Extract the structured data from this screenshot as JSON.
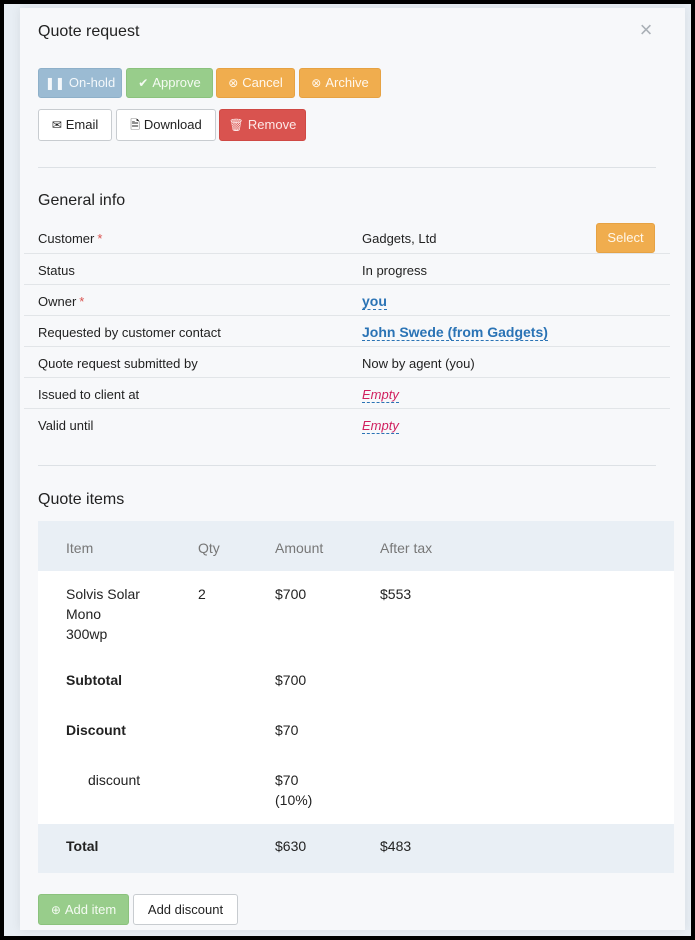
{
  "dialog": {
    "title": "Quote request",
    "close_icon": "×"
  },
  "actions": {
    "on_hold": "On-hold",
    "approve": "Approve",
    "cancel": "Cancel",
    "archive": "Archive",
    "email": "Email",
    "download": "Download",
    "remove": "Remove"
  },
  "general": {
    "heading": "General info",
    "select_label": "Select",
    "rows": [
      {
        "label": "Customer",
        "value": "Gadgets, Ltd",
        "required": "*"
      },
      {
        "label": "Status",
        "value": "In progress"
      },
      {
        "label": "Owner",
        "value": "you",
        "required": "*"
      },
      {
        "label": "Requested by customer contact",
        "value": "John Swede (from Gadgets)"
      },
      {
        "label": "Quote request submitted by",
        "value": "Now by agent (you)"
      },
      {
        "label": "Issued to client at",
        "value": "Empty"
      },
      {
        "label": "Valid until",
        "value": "Empty"
      }
    ]
  },
  "items": {
    "heading": "Quote items",
    "columns": [
      "Item",
      "Qty",
      "Amount",
      "After tax"
    ],
    "row": {
      "item_line1": "Solvis Solar",
      "item_line2": "Mono",
      "item_line3": "300wp",
      "qty": "2",
      "amount": "$700",
      "after_tax": "$553"
    },
    "subtotal": {
      "label": "Subtotal",
      "amount": "$700"
    },
    "discount": {
      "label": "Discount",
      "amount": "$70"
    },
    "discount_line": {
      "label": "discount",
      "amount": "$70",
      "percent": "(10%)"
    },
    "total": {
      "label": "Total",
      "amount": "$630",
      "after_tax": "$483"
    },
    "add_item": "Add item",
    "add_discount": "Add discount"
  },
  "colors": {
    "accent_link": "#2a73b5",
    "empty": "#d01f5e",
    "warning": "#f0ad4e",
    "danger": "#d9534f",
    "success": "#98cd8b"
  }
}
